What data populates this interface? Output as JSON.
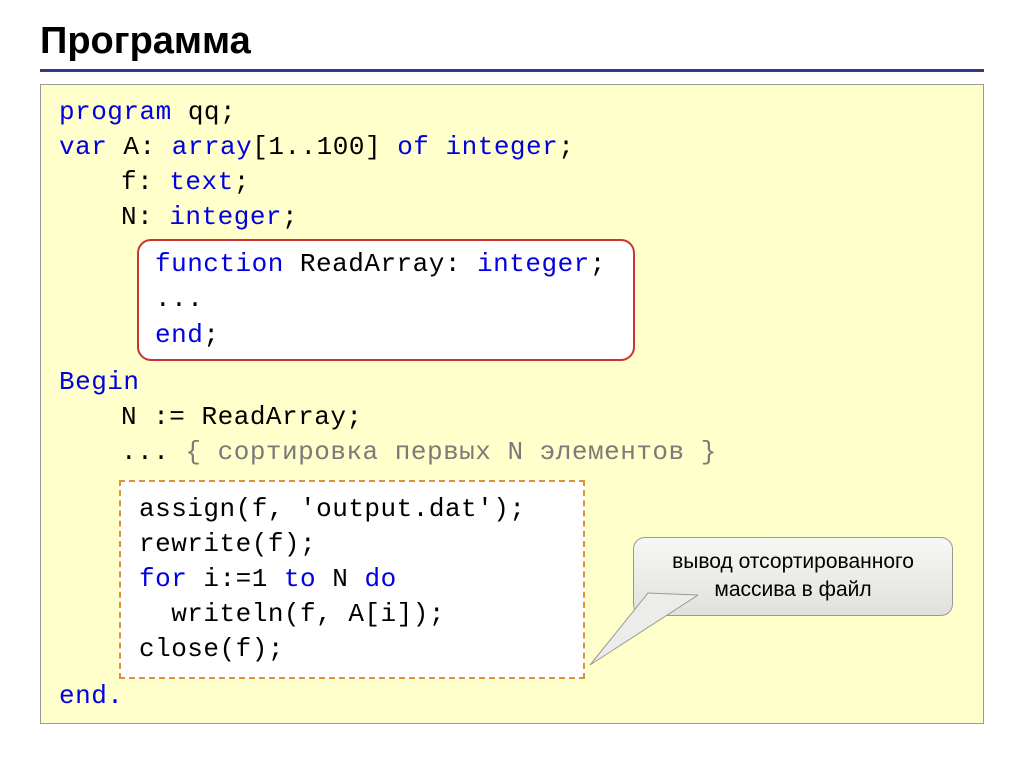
{
  "title": "Программа",
  "code": {
    "l1a": "program",
    "l1b": " qq;",
    "l2a": "var",
    "l2b": " A: ",
    "l2c": "array",
    "l2d": "[1..100] ",
    "l2e": "of",
    "l2f": " ",
    "l2g": "integer",
    "l2h": ";",
    "l3a": "f: ",
    "l3b": "text",
    "l3c": ";",
    "l4a": "N: ",
    "l4b": "integer",
    "l4c": ";",
    "fn1a": "function",
    "fn1b": " ReadArray: ",
    "fn1c": "integer",
    "fn1d": ";",
    "fn2": "...",
    "fn3": "end",
    "fn3b": ";",
    "l5": "Begin",
    "l6": "N := ReadArray;",
    "l7a": "... ",
    "l7b": "{ сортировка первых N элементов }",
    "d1": "assign(f, 'output.dat');",
    "d2": "rewrite(f);",
    "d3a": "for",
    "d3b": " i:=1 ",
    "d3c": "to",
    "d3d": " N ",
    "d3e": "do",
    "d4": "  writeln(f, A[i]);",
    "d5": "close(f);",
    "l8": "end."
  },
  "callout": "вывод отсортированного массива в файл"
}
